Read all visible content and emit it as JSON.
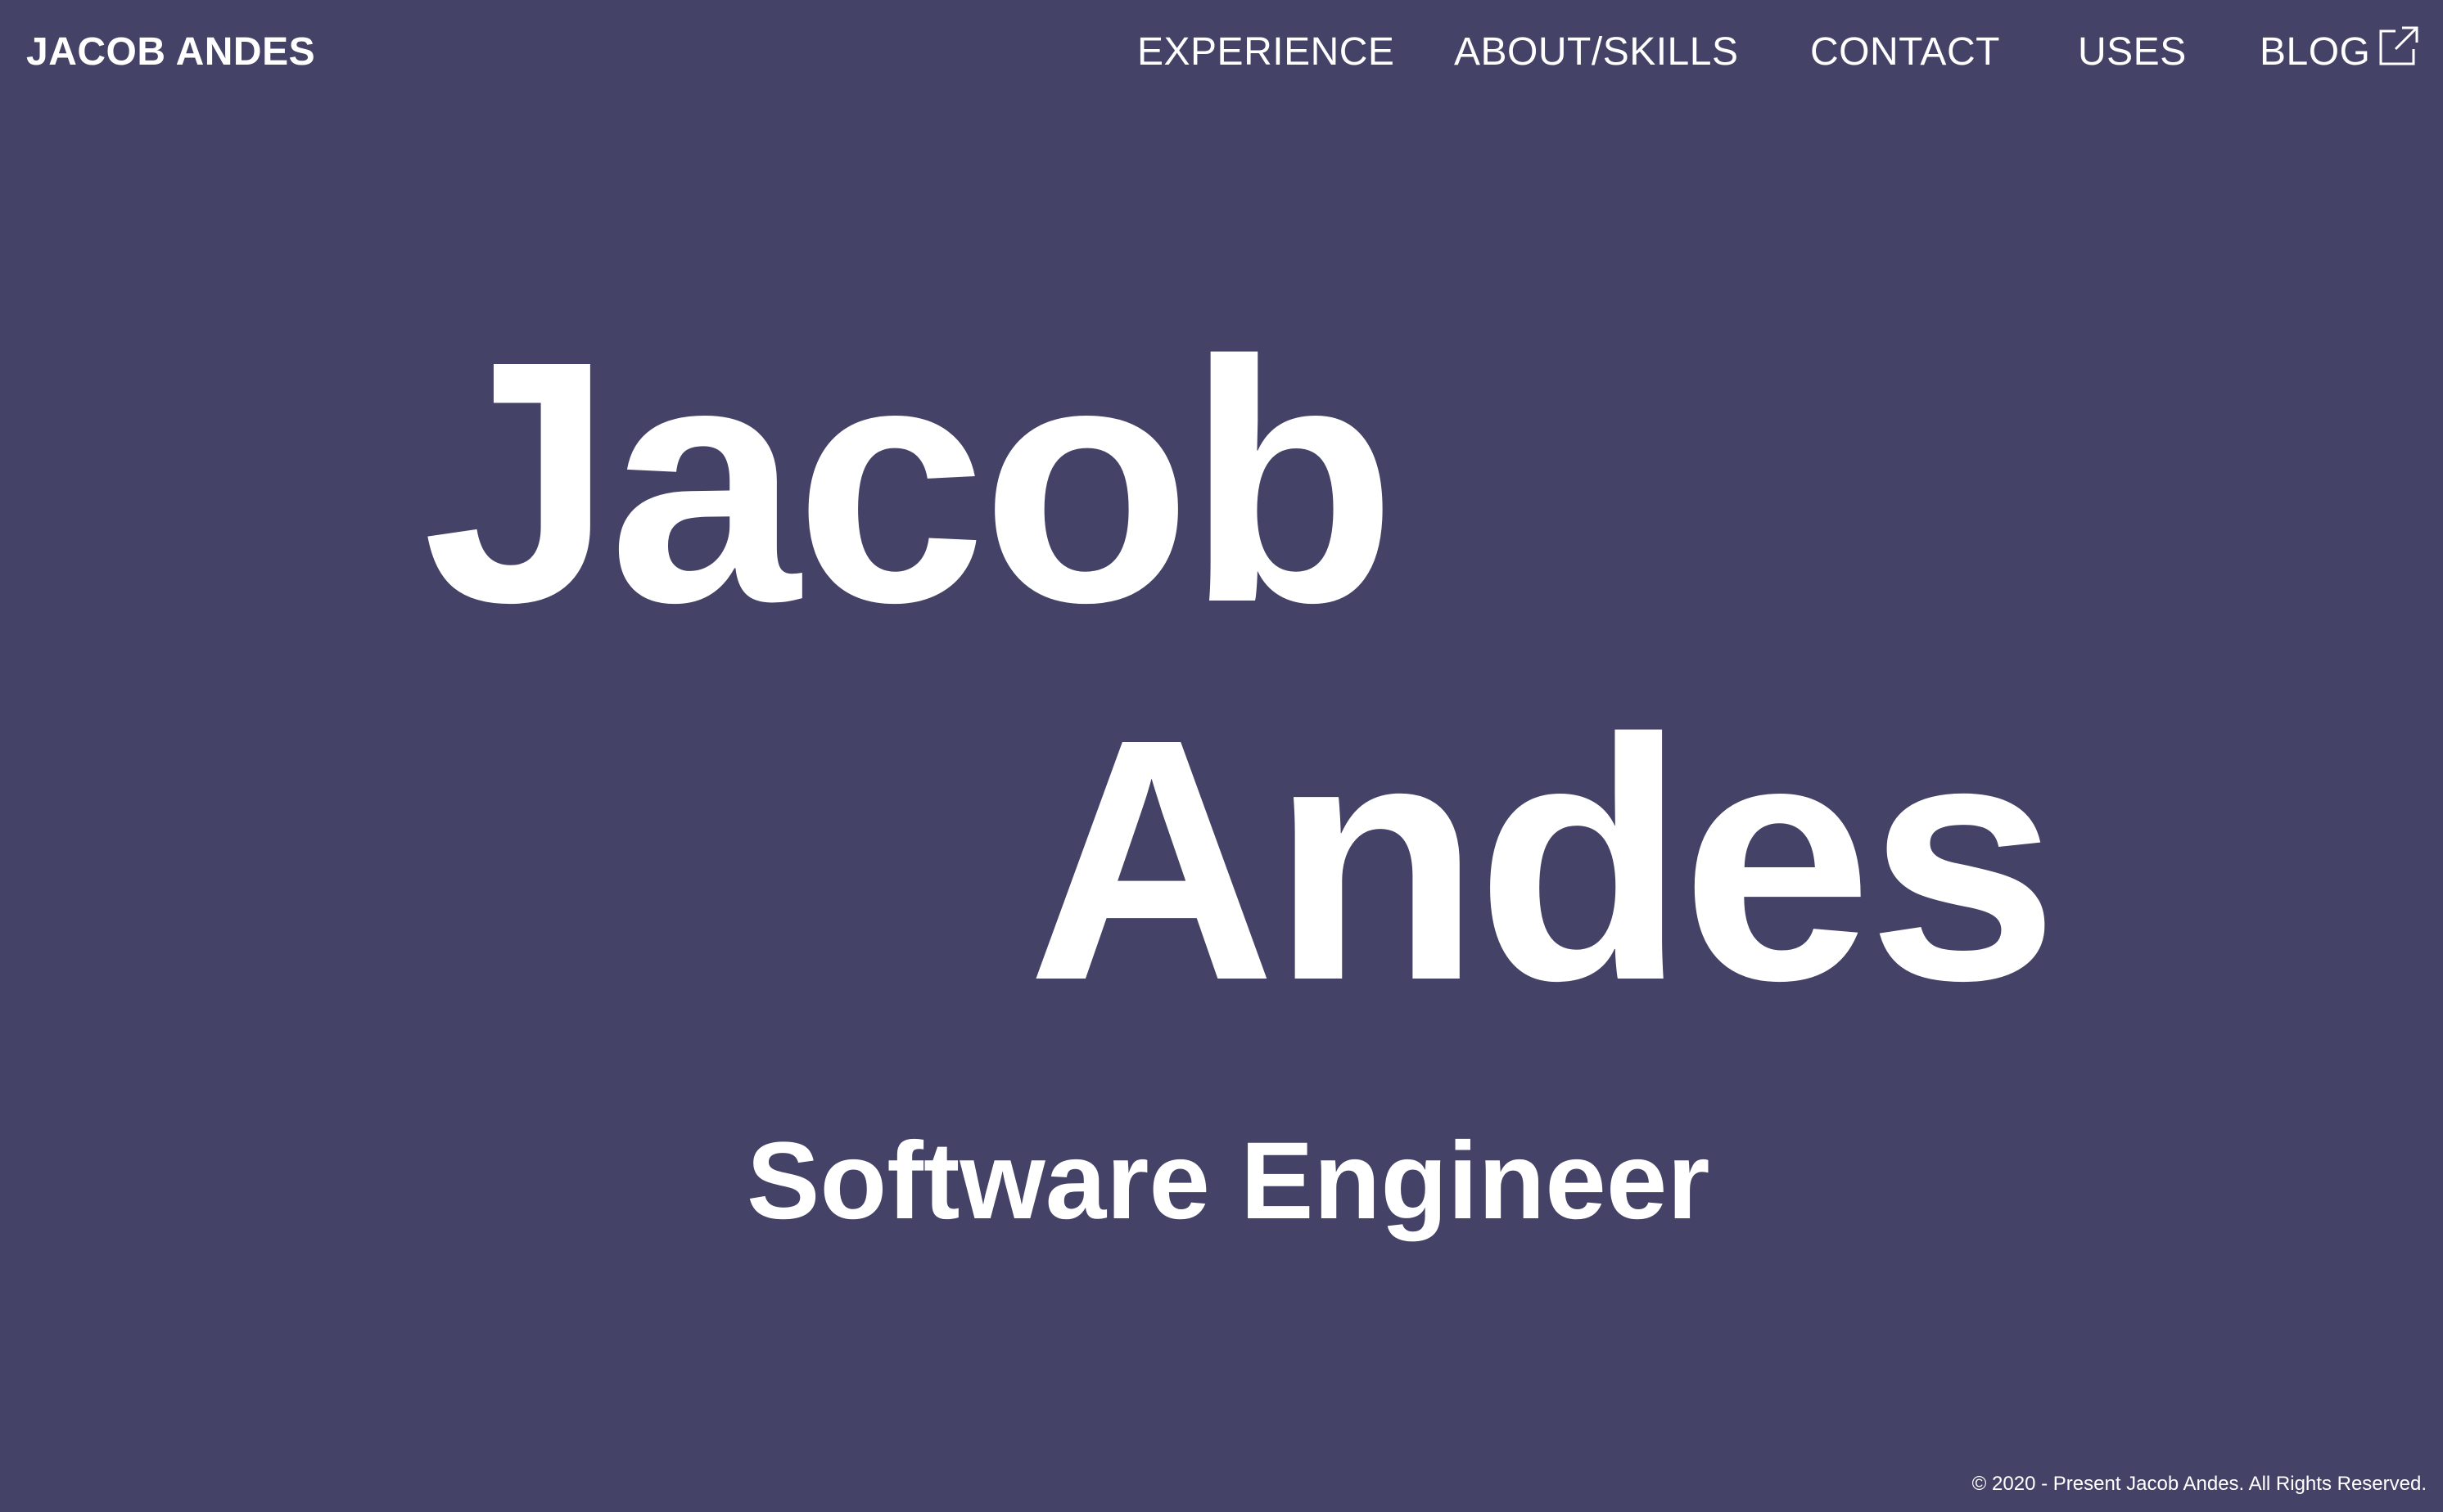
{
  "header": {
    "brand": "JACOB ANDES",
    "nav": {
      "experience": "EXPERIENCE",
      "about": "ABOUT/SKILLS",
      "contact": "CONTACT",
      "uses": "USES",
      "blog": "BLOG",
      "blog_icon": "external-link-icon"
    }
  },
  "hero": {
    "first_name": "Jacob",
    "last_name": "Andes",
    "role": "Software Engineer"
  },
  "footer": {
    "copyright": "© 2020 - Present Jacob Andes. All Rights Reserved."
  },
  "colors": {
    "background": "#444266",
    "text": "#ffffff"
  }
}
